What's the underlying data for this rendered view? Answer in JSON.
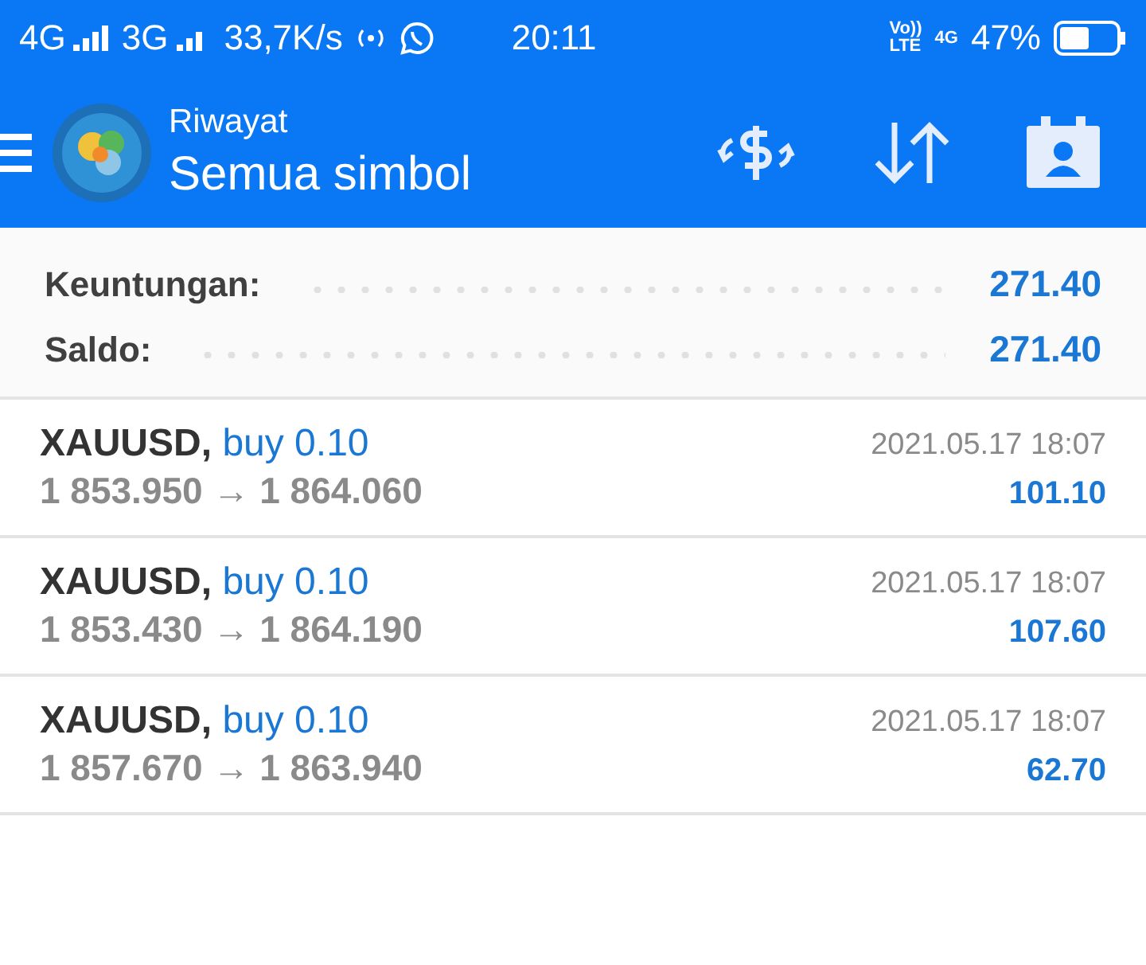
{
  "status_bar": {
    "signal_1": "4G",
    "signal_2": "3G",
    "speed": "33,7K/s",
    "time": "20:11",
    "volte_top": "Vo))",
    "volte_bottom": "LTE",
    "network": "4G",
    "battery": "47%"
  },
  "header": {
    "subtitle": "Riwayat",
    "title": "Semua simbol"
  },
  "summary": [
    {
      "label": "Keuntungan:",
      "value": "271.40"
    },
    {
      "label": "Saldo:",
      "value": "271.40"
    }
  ],
  "deals": [
    {
      "symbol": "XAUUSD,",
      "action": "buy 0.10",
      "time": "2021.05.17 18:07",
      "prices": "1 853.950 → 1 864.060",
      "profit": "101.10"
    },
    {
      "symbol": "XAUUSD,",
      "action": "buy 0.10",
      "time": "2021.05.17 18:07",
      "prices": "1 853.430 → 1 864.190",
      "profit": "107.60"
    },
    {
      "symbol": "XAUUSD,",
      "action": "buy 0.10",
      "time": "2021.05.17 18:07",
      "prices": "1 857.670 → 1 863.940",
      "profit": "62.70"
    }
  ]
}
